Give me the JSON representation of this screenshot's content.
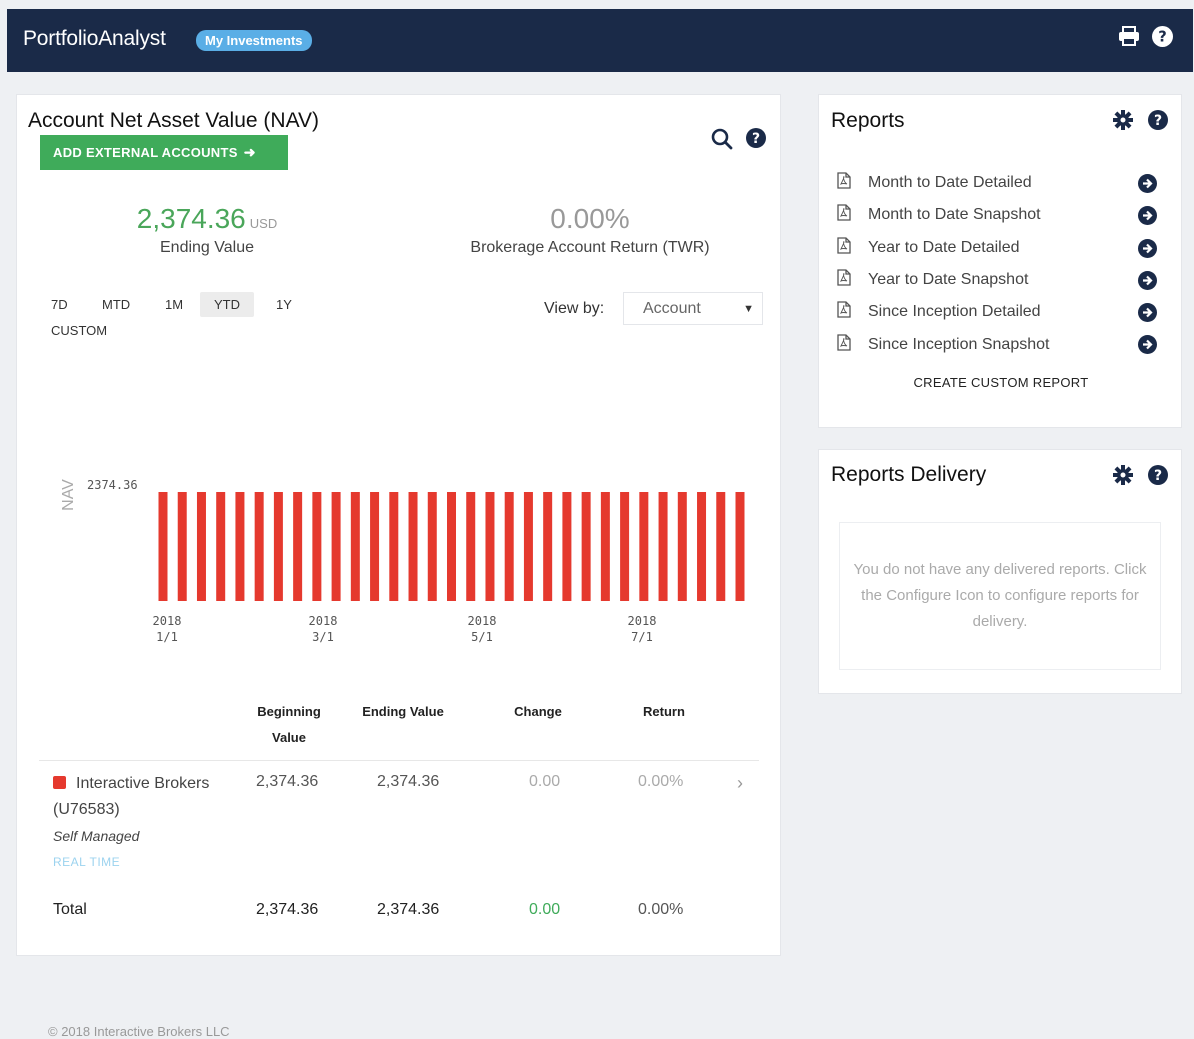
{
  "header": {
    "brand": "PortfolioAnalyst",
    "pill": "My Investments",
    "icons": [
      "print-icon",
      "help-icon"
    ]
  },
  "nav": {
    "title": "Account Net Asset Value (NAV)",
    "add_button": "ADD EXTERNAL ACCOUNTS",
    "ending_value": "2,374.36",
    "ending_unit": "USD",
    "ending_label": "Ending Value",
    "return_value": "0.00%",
    "return_label": "Brokerage Account Return (TWR)",
    "periods": [
      "7D",
      "MTD",
      "1M",
      "YTD",
      "1Y",
      "CUSTOM"
    ],
    "active_period": "YTD",
    "view_by_label": "View by:",
    "view_by_value": "Account",
    "table": {
      "headers": [
        "Beginning Value",
        "Ending Value",
        "Change",
        "Return"
      ],
      "account_name": "Interactive Brokers (U76583)",
      "account_sub": "Self Managed",
      "account_tag": "REAL TIME",
      "row": [
        "2,374.36",
        "2,374.36",
        "0.00",
        "0.00%"
      ],
      "total_label": "Total",
      "total": [
        "2,374.36",
        "2,374.36",
        "0.00",
        "0.00%"
      ]
    }
  },
  "chart_data": {
    "type": "bar",
    "ylabel": "NAV",
    "y_ticks": [
      "2374.36"
    ],
    "x_ticks": [
      {
        "year": "2018",
        "date": "1/1"
      },
      {
        "year": "2018",
        "date": "3/1"
      },
      {
        "year": "2018",
        "date": "5/1"
      },
      {
        "year": "2018",
        "date": "7/1"
      }
    ],
    "bar_count": 31,
    "values": [
      2374.36,
      2374.36,
      2374.36,
      2374.36,
      2374.36,
      2374.36,
      2374.36,
      2374.36,
      2374.36,
      2374.36,
      2374.36,
      2374.36,
      2374.36,
      2374.36,
      2374.36,
      2374.36,
      2374.36,
      2374.36,
      2374.36,
      2374.36,
      2374.36,
      2374.36,
      2374.36,
      2374.36,
      2374.36,
      2374.36,
      2374.36,
      2374.36,
      2374.36,
      2374.36,
      2374.36
    ],
    "color": "#e5392e"
  },
  "reports": {
    "title": "Reports",
    "items": [
      "Month to Date Detailed",
      "Month to Date Snapshot",
      "Year to Date Detailed",
      "Year to Date Snapshot",
      "Since Inception Detailed",
      "Since Inception Snapshot"
    ],
    "custom_link": "CREATE CUSTOM REPORT"
  },
  "delivery": {
    "title": "Reports Delivery",
    "empty_message": "You do not have any delivered reports. Click the Configure Icon to configure reports for delivery."
  },
  "footer": "© 2018 Interactive Brokers LLC",
  "colors": {
    "header_bg": "#1a2a48",
    "accent_green": "#3fab5a",
    "bar_red": "#e5392e",
    "pill_blue": "#5aaee6"
  }
}
